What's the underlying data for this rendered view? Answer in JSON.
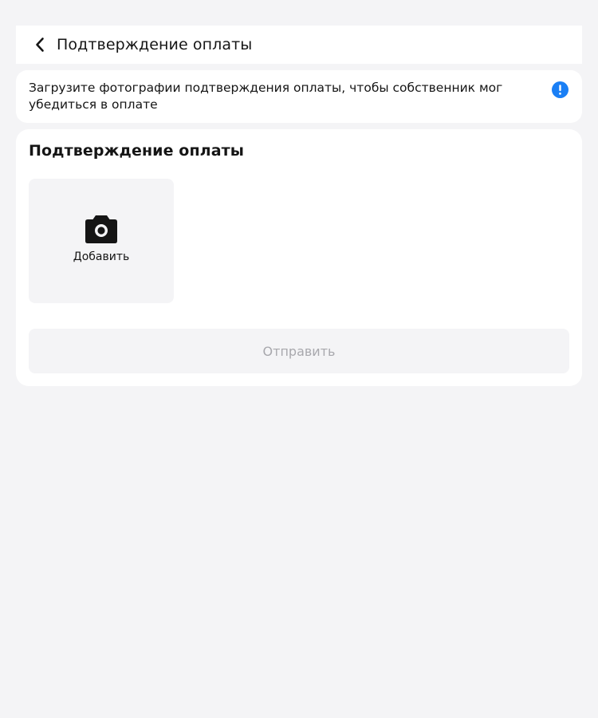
{
  "header": {
    "title": "Подтверждение оплаты",
    "back_icon": "chevron-left-icon"
  },
  "notice": {
    "text": "Загрузите фотографии подтверждения оплаты, чтобы собственник мог убедиться в оплате",
    "icon": "info-icon",
    "icon_color": "#1a7ff5"
  },
  "upload": {
    "title": "Подтверждение оплаты",
    "add_label": "Добавить",
    "add_icon": "camera-icon",
    "submit_label": "Отправить",
    "submit_enabled": false
  }
}
